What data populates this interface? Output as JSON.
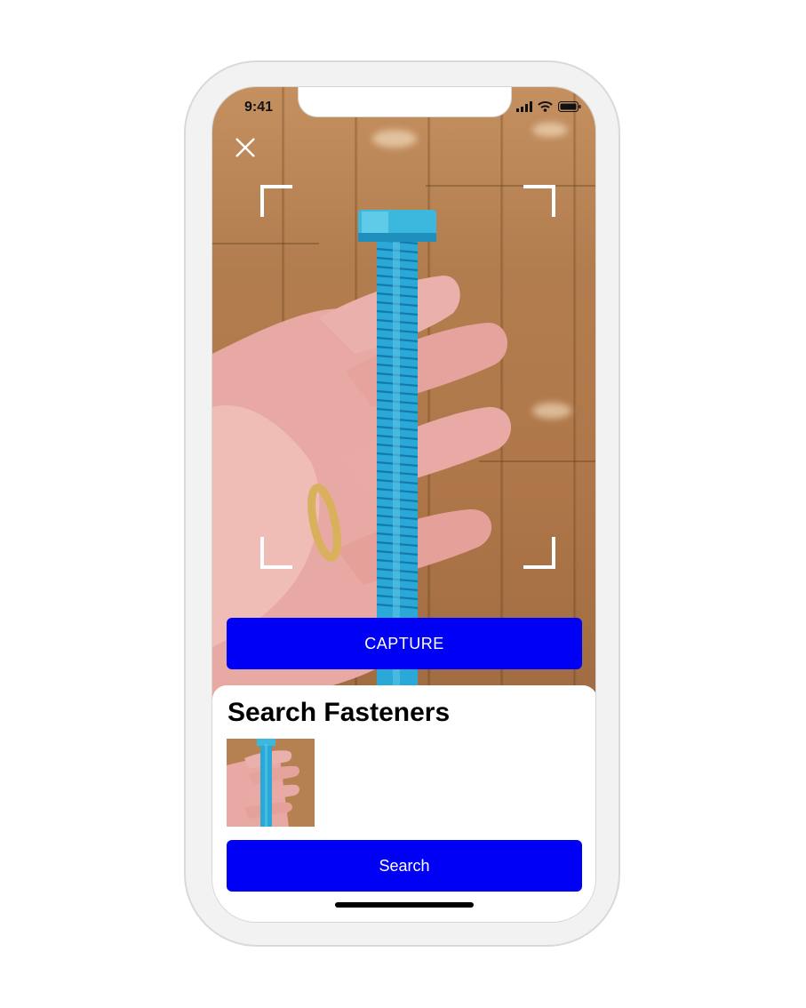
{
  "status_bar": {
    "time": "9:41"
  },
  "icons": {
    "close": "close-icon",
    "signal": "cellular-signal-icon",
    "wifi": "wifi-icon",
    "battery": "battery-icon"
  },
  "camera": {
    "capture_label": "CAPTURE"
  },
  "sheet": {
    "title": "Search Fasteners",
    "search_label": "Search"
  },
  "colors": {
    "accent": "#0000f5",
    "device_frame": "#f2f2f2",
    "bolt": "#2aa8d8"
  }
}
